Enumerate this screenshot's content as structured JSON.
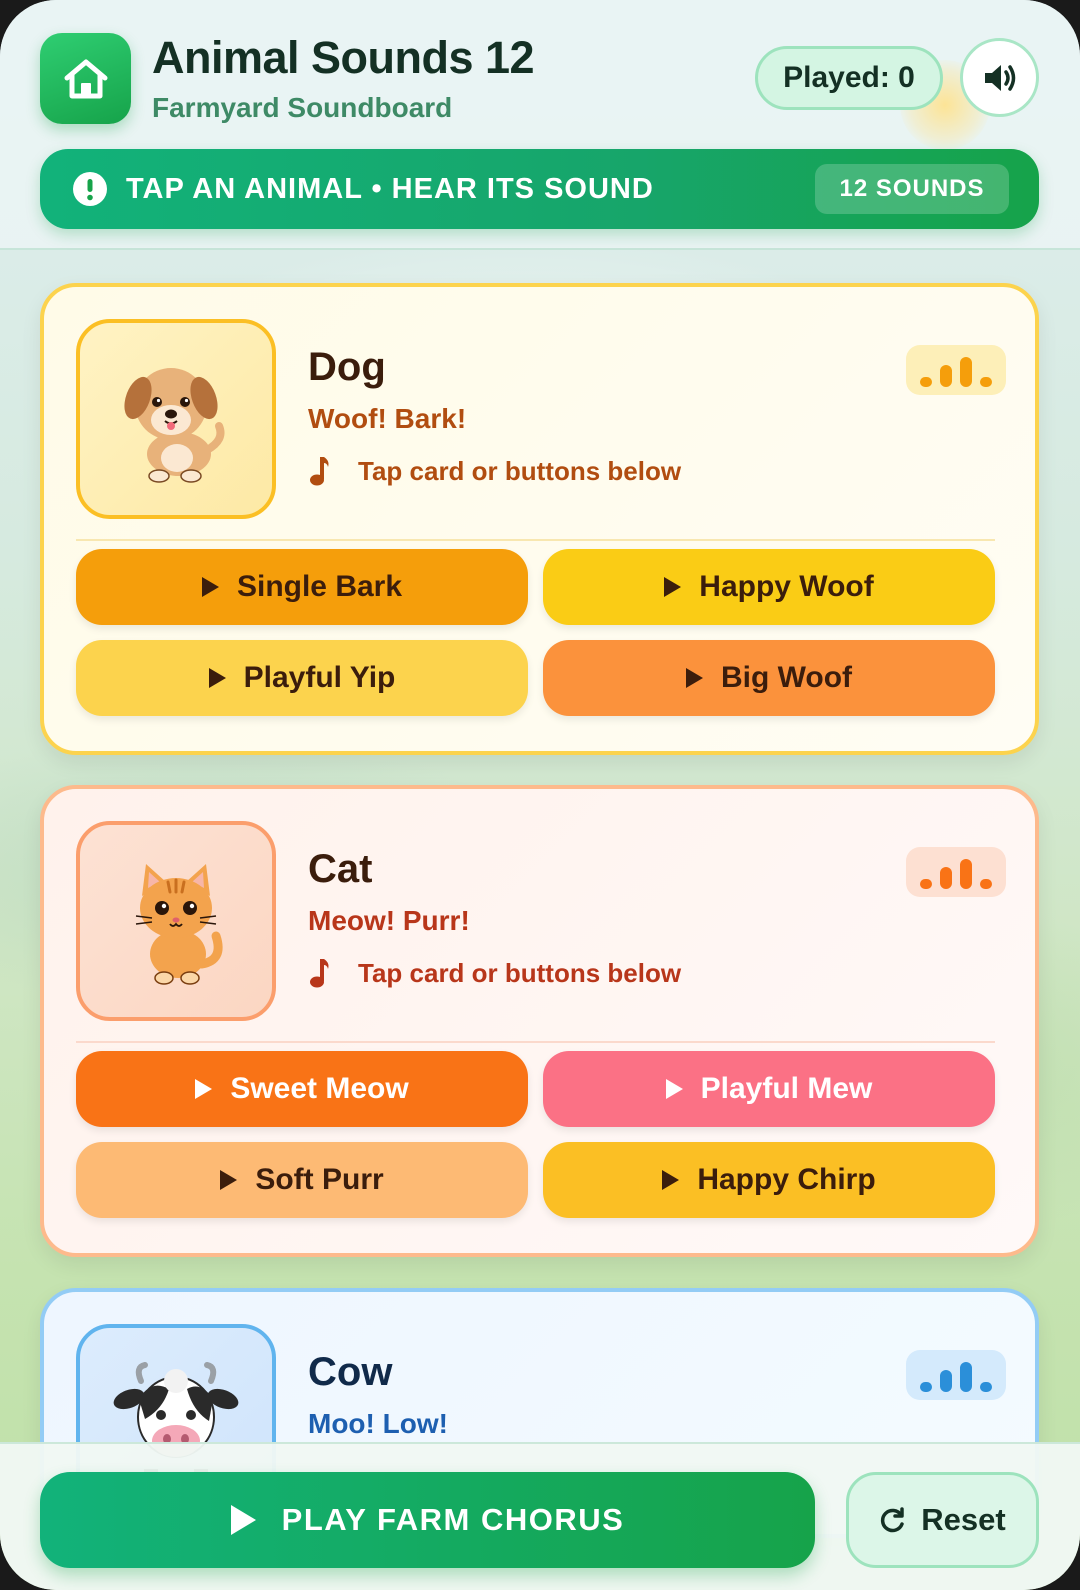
{
  "header": {
    "title": "Animal Sounds 12",
    "subtitle": "Farmyard Soundboard",
    "played_label": "Played: 0",
    "played_count": 0
  },
  "banner": {
    "text": "TAP AN ANIMAL • HEAR ITS SOUND",
    "count_label": "12 SOUNDS"
  },
  "animals": [
    {
      "name": "Dog",
      "sound": "Woof! Bark!",
      "hint": "Tap card or buttons below",
      "buttons": [
        {
          "label": "Single Bark",
          "color": "#f59e0b",
          "text_color": "#3b1d0c"
        },
        {
          "label": "Happy Woof",
          "color": "#facc15",
          "text_color": "#3b1d0c"
        },
        {
          "label": "Playful Yip",
          "color": "#fcd34d",
          "text_color": "#3b1d0c"
        },
        {
          "label": "Big Woof",
          "color": "#fb923c",
          "text_color": "#3b1d0c"
        }
      ]
    },
    {
      "name": "Cat",
      "sound": "Meow! Purr!",
      "hint": "Tap card or buttons below",
      "buttons": [
        {
          "label": "Sweet Meow",
          "color": "#f97316",
          "text_color": "#ffffff"
        },
        {
          "label": "Playful Mew",
          "color": "#fb7185",
          "text_color": "#ffffff"
        },
        {
          "label": "Soft Purr",
          "color": "#fdba74",
          "text_color": "#3b1d0c"
        },
        {
          "label": "Happy Chirp",
          "color": "#fbbf24",
          "text_color": "#3b1d0c"
        }
      ]
    },
    {
      "name": "Cow",
      "sound": "Moo! Low!"
    }
  ],
  "footer": {
    "chorus_label": "PLAY FARM CHORUS",
    "reset_label": "Reset"
  },
  "icons": {
    "home": "home-icon",
    "sound": "speaker-icon",
    "alert": "alert-icon",
    "note": "music-note-icon",
    "play": "play-icon",
    "reset": "refresh-icon"
  },
  "colors": {
    "brand_green": "#16a34a",
    "dog_accent": "#fbbf24",
    "cat_accent": "#fb9e6c",
    "cow_accent": "#60b4ee"
  }
}
